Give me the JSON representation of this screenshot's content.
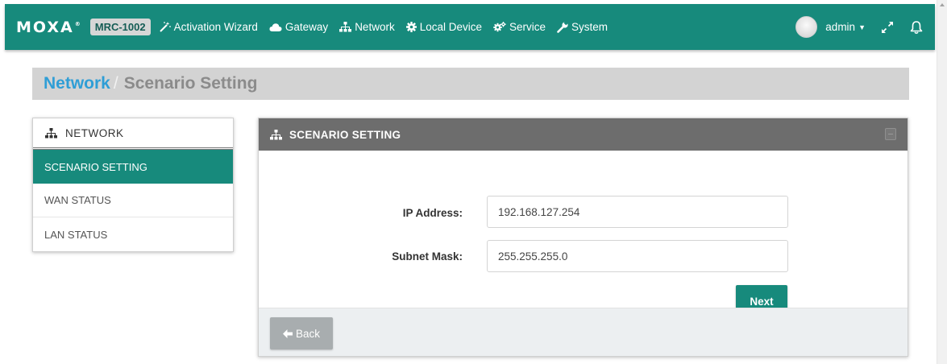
{
  "header": {
    "logo": "MOXA",
    "logo_tm": "®",
    "model": "MRC-1002",
    "nav": [
      {
        "label": "Activation Wizard",
        "icon": "magic-wand-icon"
      },
      {
        "label": "Gateway",
        "icon": "cloud-icon"
      },
      {
        "label": "Network",
        "icon": "sitemap-icon"
      },
      {
        "label": "Local Device",
        "icon": "gear-icon"
      },
      {
        "label": "Service",
        "icon": "gears-icon"
      },
      {
        "label": "System",
        "icon": "wrench-icon"
      }
    ],
    "user": "admin"
  },
  "breadcrumb": {
    "parent": "Network",
    "separator": "/",
    "current": "Scenario Setting"
  },
  "sidebar": {
    "title": "NETWORK",
    "items": [
      {
        "label": "SCENARIO SETTING",
        "active": true
      },
      {
        "label": "WAN STATUS",
        "active": false
      },
      {
        "label": "LAN STATUS",
        "active": false
      }
    ]
  },
  "panel": {
    "title": "SCENARIO SETTING",
    "ip_label": "IP Address:",
    "ip_value": "192.168.127.254",
    "mask_label": "Subnet Mask:",
    "mask_value": "255.255.255.0",
    "next_label": "Next",
    "back_label": "Back"
  },
  "colors": {
    "brand": "#178a7c",
    "breadcrumb_bg": "#d3d3d3",
    "breadcrumb_link": "#2f9ed6",
    "panel_header": "#6d6d6d"
  }
}
